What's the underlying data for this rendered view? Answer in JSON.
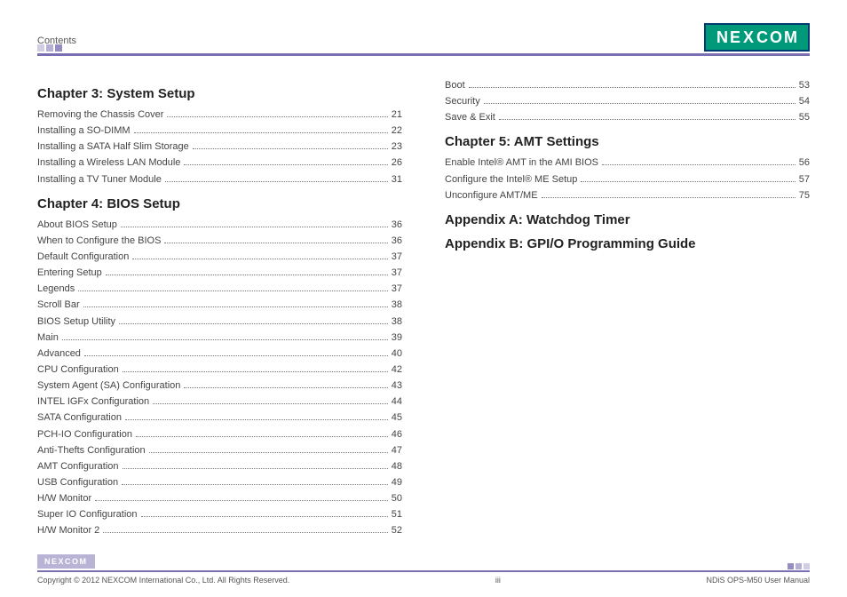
{
  "header": {
    "section_label": "Contents",
    "logo_text_left": "NE",
    "logo_text_x": "X",
    "logo_text_right": "COM"
  },
  "left_column": [
    {
      "title": "Chapter 3: System Setup",
      "entries": [
        {
          "label": "Removing the Chassis Cover",
          "page": "21"
        },
        {
          "label": "Installing a SO-DIMM",
          "page": "22"
        },
        {
          "label": "Installing a SATA Half Slim Storage",
          "page": "23"
        },
        {
          "label": "Installing a Wireless LAN Module",
          "page": "26"
        },
        {
          "label": "Installing a TV Tuner Module",
          "page": "31"
        }
      ]
    },
    {
      "title": "Chapter 4: BIOS Setup",
      "entries": [
        {
          "label": "About BIOS Setup",
          "page": "36"
        },
        {
          "label": "When to Configure the BIOS",
          "page": "36"
        },
        {
          "label": "Default Configuration",
          "page": "37"
        },
        {
          "label": "Entering Setup",
          "page": "37"
        },
        {
          "label": "Legends",
          "page": "37"
        },
        {
          "label": "Scroll Bar",
          "page": "38"
        },
        {
          "label": "BIOS Setup Utility",
          "page": "38"
        },
        {
          "label": "Main",
          "page": "39"
        },
        {
          "label": "Advanced",
          "page": "40"
        },
        {
          "label": "CPU Configuration",
          "page": "42"
        },
        {
          "label": "System Agent (SA) Configuration",
          "page": "43"
        },
        {
          "label": "INTEL IGFx Configuration",
          "page": "44"
        },
        {
          "label": "SATA Configuration",
          "page": "45"
        },
        {
          "label": "PCH-IO Configuration",
          "page": "46"
        },
        {
          "label": "Anti-Thefts Configuration",
          "page": "47"
        },
        {
          "label": "AMT Configuration",
          "page": "48"
        },
        {
          "label": "USB Configuration",
          "page": "49"
        },
        {
          "label": "H/W Monitor",
          "page": "50"
        },
        {
          "label": "Super IO Configuration",
          "page": "51"
        },
        {
          "label": "H/W Monitor 2",
          "page": "52"
        }
      ]
    }
  ],
  "right_column": [
    {
      "title": null,
      "entries": [
        {
          "label": "Boot",
          "page": "53"
        },
        {
          "label": "Security",
          "page": "54"
        },
        {
          "label": "Save & Exit",
          "page": "55"
        }
      ]
    },
    {
      "title": "Chapter 5: AMT Settings",
      "entries": [
        {
          "label": "Enable Intel® AMT in the AMI BIOS",
          "page": "56"
        },
        {
          "label": "Configure the Intel® ME Setup",
          "page": "57"
        },
        {
          "label": "Unconfigure AMT/ME",
          "page": "75"
        }
      ]
    },
    {
      "title": "Appendix A: Watchdog Timer",
      "entries": []
    },
    {
      "title": "Appendix B: GPI/O Programming Guide",
      "entries": []
    }
  ],
  "footer": {
    "logo_text": "NEXCOM",
    "copyright": "Copyright © 2012 NEXCOM International Co., Ltd. All Rights Reserved.",
    "page_num": "iii",
    "doc_title": "NDiS OPS-M50 User Manual"
  }
}
